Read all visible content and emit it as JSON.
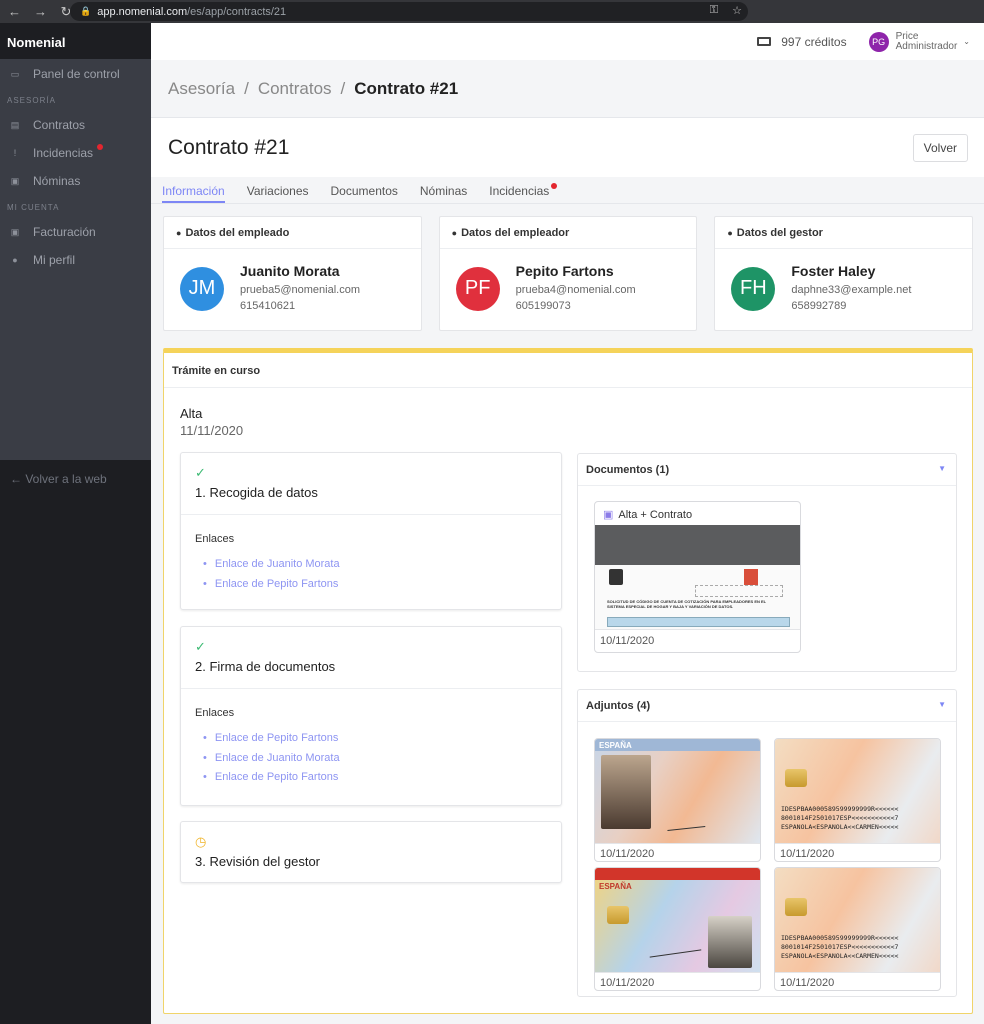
{
  "browser": {
    "url_host": "app.nomenial.com",
    "url_path": "/es/app/contracts/21"
  },
  "sidebar": {
    "brand": "Nomenial",
    "top_item": {
      "label": "Panel de control",
      "icon": "dashboard-icon"
    },
    "section_asesoria": "ASESORÍA",
    "asesoria_items": [
      {
        "label": "Contratos",
        "icon": "document-icon"
      },
      {
        "label": "Incidencias",
        "icon": "exclamation-icon",
        "badge_color": "#e3262f"
      },
      {
        "label": "Nóminas",
        "icon": "money-icon"
      }
    ],
    "section_cuenta": "MI CUENTA",
    "cuenta_items": [
      {
        "label": "Facturación",
        "icon": "money-icon"
      },
      {
        "label": "Mi perfil",
        "icon": "user-icon"
      }
    ],
    "back_label": "← Volver a la web"
  },
  "topbar": {
    "credits": "997 créditos",
    "user_initials": "PG",
    "user_name": "Price",
    "user_role": "Administrador"
  },
  "breadcrumb": {
    "items": [
      "Asesoría",
      "Contratos"
    ],
    "current": "Contrato #21"
  },
  "header": {
    "title": "Contrato #21",
    "back_button": "Volver"
  },
  "tabs": [
    {
      "label": "Información",
      "active": true
    },
    {
      "label": "Variaciones"
    },
    {
      "label": "Documentos"
    },
    {
      "label": "Nóminas"
    },
    {
      "label": "Incidencias",
      "badge": true
    }
  ],
  "people": [
    {
      "title": "Datos del empleado",
      "initials": "JM",
      "color": "#2f8fe0",
      "name": "Juanito Morata",
      "email": "prueba5@nomenial.com",
      "phone": "615410621"
    },
    {
      "title": "Datos del empleador",
      "initials": "PF",
      "color": "#e0303d",
      "name": "Pepito Fartons",
      "email": "prueba4@nomenial.com",
      "phone": "605199073"
    },
    {
      "title": "Datos del gestor",
      "initials": "FH",
      "color": "#1e9466",
      "name": "Foster Haley",
      "email": "daphne33@example.net",
      "phone": "658992789"
    }
  ],
  "tramite": {
    "header": "Trámite en curso",
    "type": "Alta",
    "date": "11/11/2020",
    "steps": [
      {
        "title": "1. Recogida de datos",
        "status": "done",
        "links_label": "Enlaces",
        "links": [
          "Enlace de Juanito Morata",
          "Enlace de Pepito Fartons"
        ]
      },
      {
        "title": "2. Firma de documentos",
        "status": "done",
        "links_label": "Enlaces",
        "links": [
          "Enlace de Pepito Fartons",
          "Enlace de Juanito Morata",
          "Enlace de Pepito Fartons"
        ]
      },
      {
        "title": "3. Revisión del gestor",
        "status": "pending"
      }
    ],
    "documentos": {
      "title": "Documentos (1)",
      "items": [
        {
          "name": "Alta + Contrato",
          "date": "10/11/2020",
          "preview_title": "SOLICITUD DE CÓDIGO DE CUENTA DE COTIZACIÓN PARA EMPLEADORES EN EL SISTEMA ESPECIAL DE HOGAR Y BAJA Y VARIACIÓN DE DATOS."
        }
      ]
    },
    "adjuntos": {
      "title": "Adjuntos (4)",
      "items": [
        {
          "date": "10/11/2020",
          "kind": "dni-front",
          "header": "ESPAÑA"
        },
        {
          "date": "10/11/2020",
          "kind": "dni-back",
          "mrz": [
            "IDESPBAA000589599999999R<<<<<<",
            "8001014F2501017ESP<<<<<<<<<<<7",
            "ESPANOLA<ESPANOLA<<CARMEN<<<<<"
          ]
        },
        {
          "date": "10/11/2020",
          "kind": "dni-front-2",
          "header": "ESPAÑA"
        },
        {
          "date": "10/11/2020",
          "kind": "dni-back",
          "mrz": [
            "IDESPBAA000589599999999R<<<<<<",
            "8001014F2501017ESP<<<<<<<<<<<7",
            "ESPANOLA<ESPANOLA<<CARMEN<<<<<"
          ]
        }
      ]
    }
  }
}
